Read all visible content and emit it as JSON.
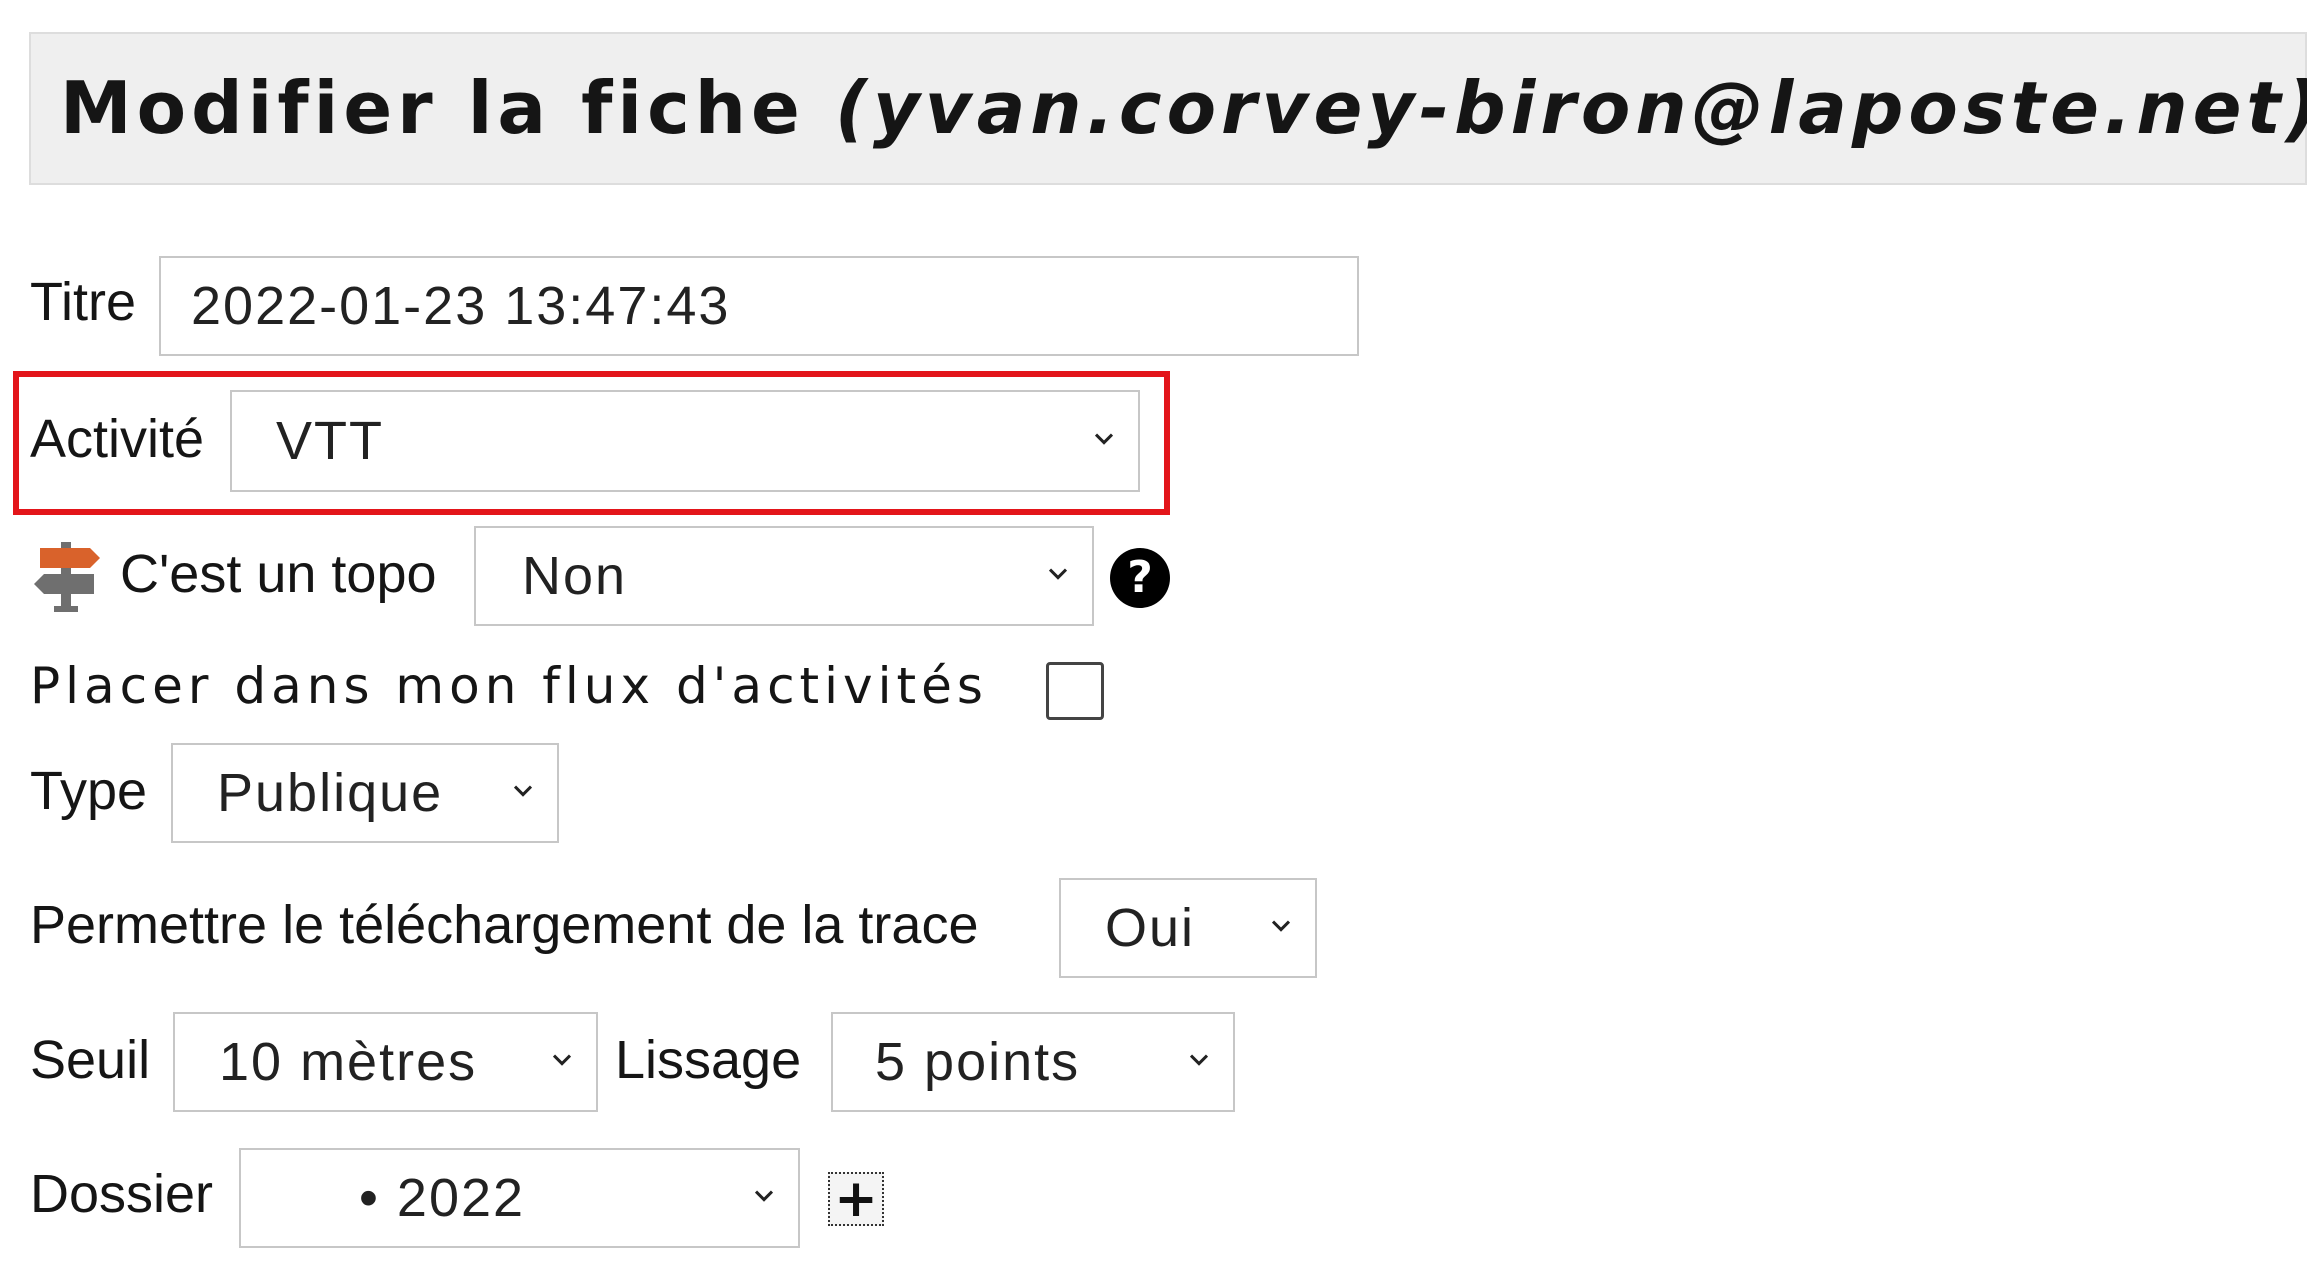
{
  "header": {
    "title_prefix": "Modifier la fiche",
    "email": "(yvan.corvey-biron@laposte.net)"
  },
  "form": {
    "titre": {
      "label": "Titre",
      "value": "2022-01-23 13:47:43"
    },
    "activite": {
      "label": "Activité",
      "value": "VTT"
    },
    "topo": {
      "label": "C'est un topo",
      "value": "Non",
      "help_symbol": "?"
    },
    "flux": {
      "label": "Placer dans mon flux d'activités",
      "checked": false
    },
    "type": {
      "label": "Type",
      "value": "Publique"
    },
    "telechargement": {
      "label": "Permettre le téléchargement de la trace",
      "value": "Oui"
    },
    "seuil": {
      "label": "Seuil",
      "value": "10 mètres"
    },
    "lissage": {
      "label": "Lissage",
      "value": "5 points"
    },
    "dossier": {
      "label": "Dossier",
      "value": "• 2022",
      "add_symbol": "+"
    }
  },
  "icons": {
    "topo": "signpost-icon",
    "help": "question-circle-icon",
    "chevron": "chevron-down-icon",
    "add": "plus-icon"
  },
  "colors": {
    "highlight": "#e3151a",
    "header_bg": "#efefef",
    "signpost_orange": "#d9622b",
    "signpost_gray": "#6f6f6f"
  }
}
